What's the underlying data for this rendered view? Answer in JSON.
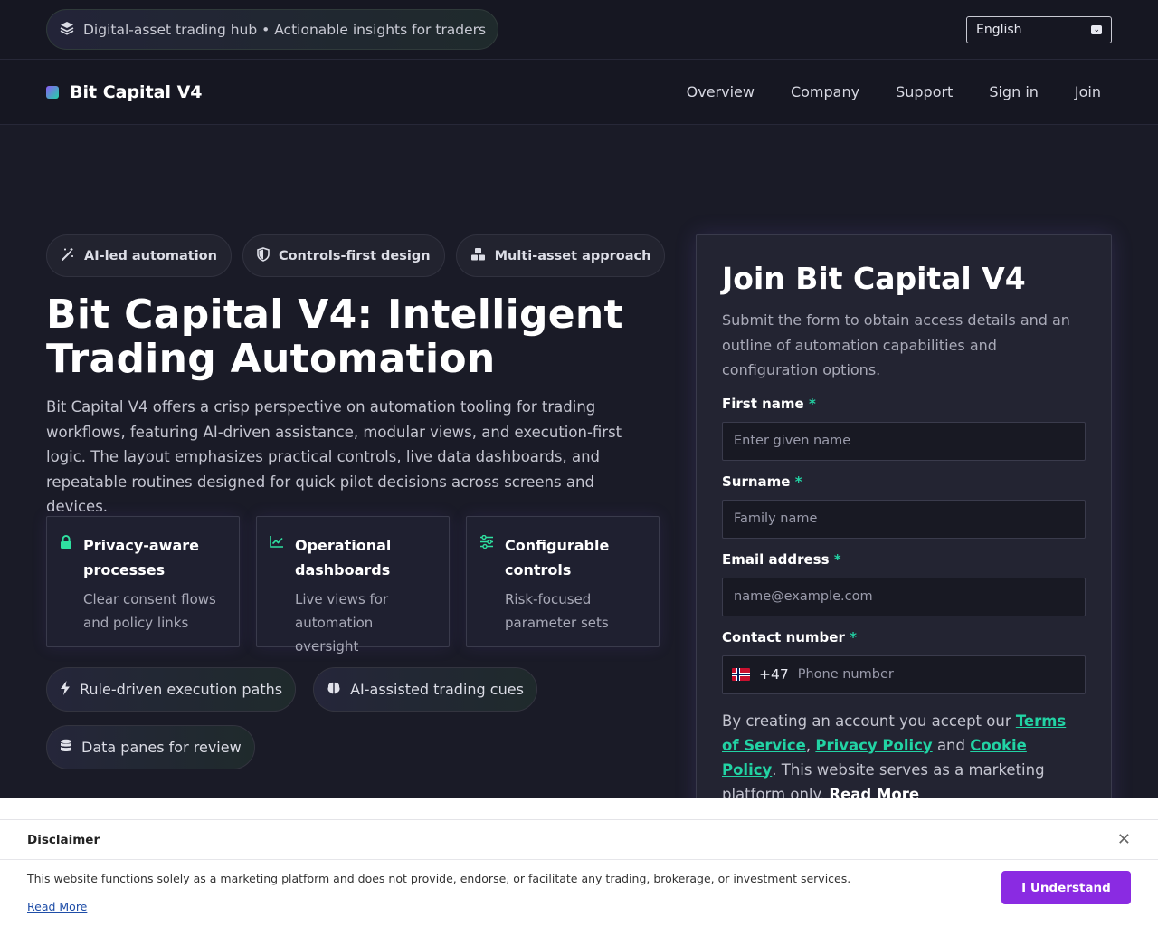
{
  "topbar": {
    "tagline": "Digital-asset trading hub • Actionable insights for traders",
    "language": "English"
  },
  "nav": {
    "brand": "Bit Capital V4",
    "links": [
      "Overview",
      "Company",
      "Support",
      "Sign in",
      "Join"
    ]
  },
  "hero": {
    "chips": [
      {
        "label": "AI-led automation",
        "icon": "magic-wand-icon"
      },
      {
        "label": "Controls-first design",
        "icon": "shield-icon"
      },
      {
        "label": "Multi-asset approach",
        "icon": "cubes-icon"
      }
    ],
    "title": "Bit Capital V4: Intelligent Trading Automation",
    "description": "Bit Capital V4 offers a crisp perspective on automation tooling for trading workflows, featuring AI-driven assistance, modular views, and execution-first logic. The layout emphasizes practical controls, live data dashboards, and repeatable routines designed for quick pilot decisions across screens and devices.",
    "features": [
      {
        "title": "Privacy-aware processes",
        "subtitle": "Clear consent flows and policy links",
        "icon": "lock-icon"
      },
      {
        "title": "Operational dashboards",
        "subtitle": "Live views for automation oversight",
        "icon": "line-chart-icon"
      },
      {
        "title": "Configurable controls",
        "subtitle": "Risk-focused parameter sets",
        "icon": "sliders-icon"
      }
    ],
    "tags": [
      {
        "label": "Rule-driven execution paths",
        "icon": "bolt-icon"
      },
      {
        "label": "AI-assisted trading cues",
        "icon": "brain-icon"
      },
      {
        "label": "Data panes for review",
        "icon": "database-icon"
      }
    ]
  },
  "form": {
    "title": "Join Bit Capital V4",
    "subtitle": "Submit the form to obtain access details and an outline of automation capabilities and configuration options.",
    "first_name_label": "First name",
    "first_name_placeholder": "Enter given name",
    "surname_label": "Surname",
    "surname_placeholder": "Family name",
    "email_label": "Email address",
    "email_placeholder": "name@example.com",
    "phone_label": "Contact number",
    "phone_code": "+47",
    "phone_placeholder": "Phone number",
    "required_mark": "*",
    "consent_prefix": "By creating an account you accept our ",
    "terms": "Terms of Service",
    "privacy": "Privacy Policy",
    "and": " and ",
    "cookie": "Cookie Policy",
    "consent_suffix": ". This website serves as a marketing platform only. ",
    "read_more": "Read More"
  },
  "disclaimer": {
    "title": "Disclaimer",
    "text": "This website functions solely as a marketing platform and does not provide, endorse, or facilitate any trading, brokerage, or investment services.",
    "read_more": "Read More",
    "button": "I Understand"
  }
}
